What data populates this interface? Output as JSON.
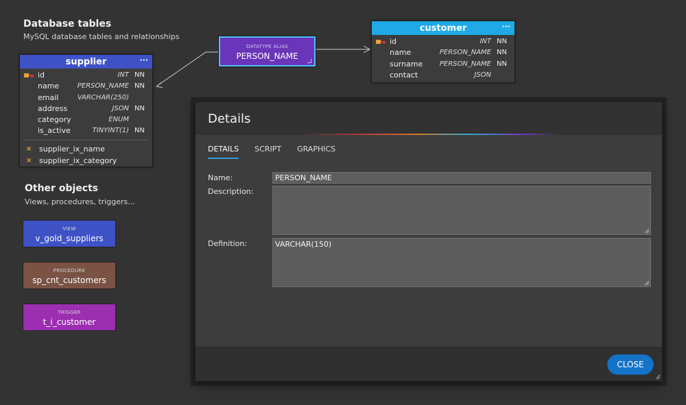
{
  "database_tables": {
    "title": "Database tables",
    "subtitle": "MySQL database tables and relationships"
  },
  "supplier": {
    "name": "supplier",
    "menu": "···",
    "header_color": "#3e52c6",
    "columns": [
      {
        "name": "id",
        "type": "INT",
        "nn": "NN",
        "pk": true
      },
      {
        "name": "name",
        "type": "PERSON_NAME",
        "nn": "NN"
      },
      {
        "name": "email",
        "type": "VARCHAR(250)",
        "nn": ""
      },
      {
        "name": "address",
        "type": "JSON",
        "nn": "NN"
      },
      {
        "name": "category",
        "type": "ENUM",
        "nn": ""
      },
      {
        "name": "is_active",
        "type": "TINYINT(1)",
        "nn": "NN"
      }
    ],
    "indexes": [
      {
        "icon": "index-icon",
        "name": "supplier_ix_name"
      },
      {
        "icon": "index-icon",
        "name": "supplier_ix_category"
      }
    ]
  },
  "customer": {
    "name": "customer",
    "menu": "···",
    "header_color": "#1fa9e6",
    "columns": [
      {
        "name": "id",
        "type": "INT",
        "nn": "NN",
        "pk": true
      },
      {
        "name": "name",
        "type": "PERSON_NAME",
        "nn": "NN"
      },
      {
        "name": "surname",
        "type": "PERSON_NAME",
        "nn": "NN"
      },
      {
        "name": "contact",
        "type": "JSON",
        "nn": ""
      }
    ]
  },
  "alias": {
    "caption": "DATATYPE ALIAS",
    "value": "PERSON_NAME"
  },
  "other_objects": {
    "title": "Other objects",
    "subtitle": "Views, procedures, triggers...",
    "items": [
      {
        "caption": "VIEW",
        "value": "v_gold_suppliers",
        "color": "#3e52c6"
      },
      {
        "caption": "PROCEDURE",
        "value": "sp_cnt_customers",
        "color": "#7a5345"
      },
      {
        "caption": "TRIGGER",
        "value": "t_i_customer",
        "color": "#9b2fb0"
      }
    ]
  },
  "details": {
    "title": "Details",
    "tabs": [
      "DETAILS",
      "SCRIPT",
      "GRAPHICS"
    ],
    "active_tab": "DETAILS",
    "name_label": "Name:",
    "name_value": "PERSON_NAME",
    "description_label": "Description:",
    "description_value": "",
    "definition_label": "Definition:",
    "definition_value": "VARCHAR(150)",
    "close_label": "CLOSE"
  },
  "colors": {
    "background": "#333333",
    "accent": "#1674c8",
    "alias": "#6a35b8",
    "alias_border": "#4ec3ff",
    "pk_key": "#e8a23a"
  }
}
